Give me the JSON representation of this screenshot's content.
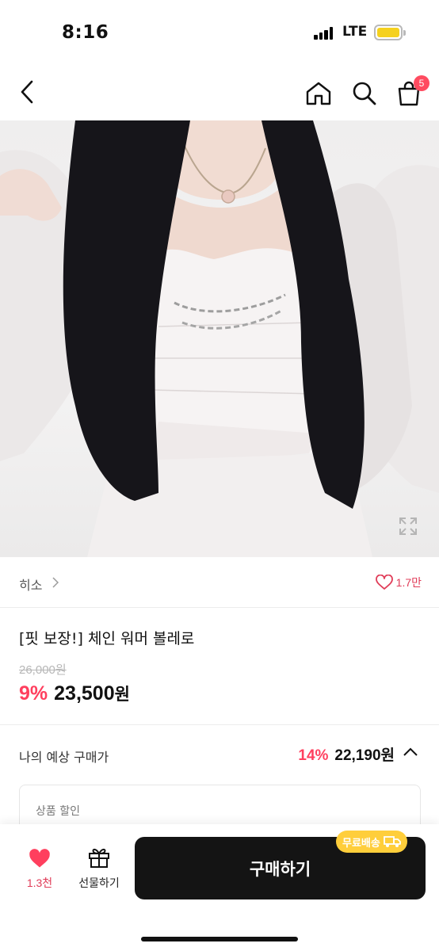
{
  "status_bar": {
    "time": "8:16",
    "network": "LTE"
  },
  "header": {
    "cart_badge": "5"
  },
  "product": {
    "brand": "히소",
    "likes": "1.7만",
    "title": "[핏 보장!] 체인 워머 볼레로",
    "original_price": "26,000원",
    "discount": "9%",
    "sale_price": "23,500",
    "sale_currency": "원"
  },
  "expected": {
    "label": "나의 예상 구매가",
    "discount": "14%",
    "price": "22,190원",
    "breakdown_label": "상품 할인"
  },
  "bottom_bar": {
    "like_count": "1.3천",
    "gift_label": "선물하기",
    "buy_label": "구매하기",
    "free_shipping": "무료배송"
  },
  "colors": {
    "accent": "#ff3f5e",
    "badge": "#ff4b60",
    "free_shipping_bg": "#ffce3b",
    "button_bg": "#141414"
  }
}
